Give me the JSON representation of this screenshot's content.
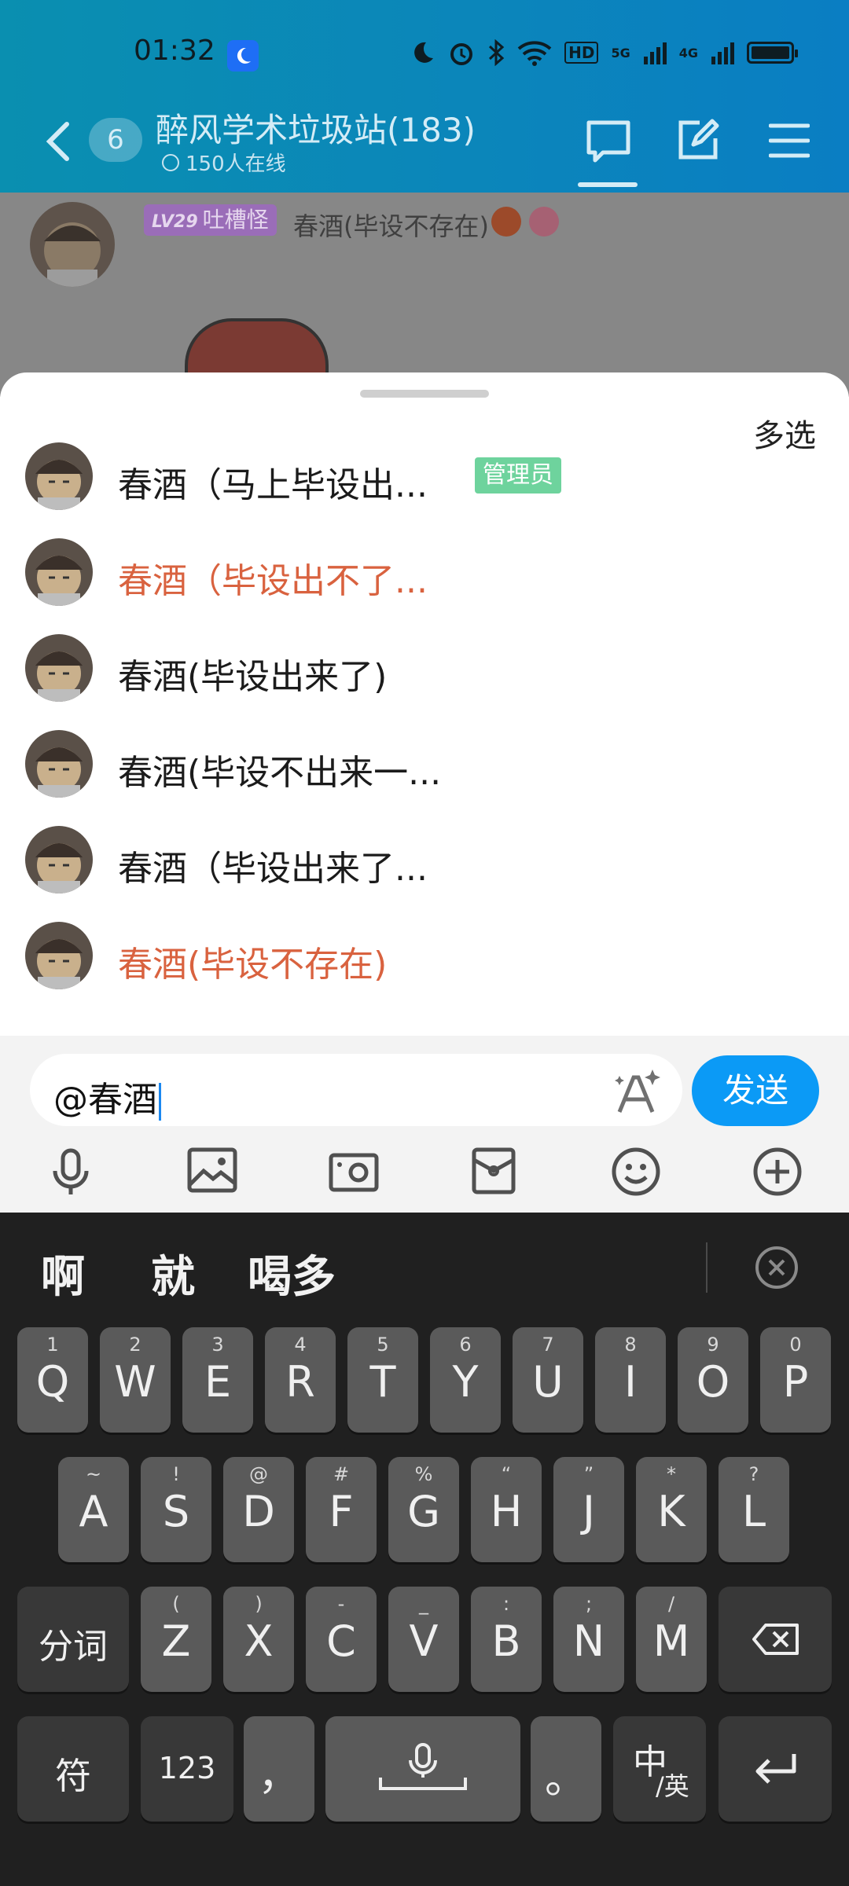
{
  "status_bar": {
    "time": "01:32",
    "hd_label": "HD",
    "sig1": "5G",
    "sig2": "4G"
  },
  "header": {
    "back_count": "6",
    "title": "醉风学术垃圾站(183)",
    "online": "150人在线"
  },
  "chat_preview": {
    "level": "LV29",
    "level_title": "吐槽怪",
    "sender": "春酒(毕设不存在)"
  },
  "mention_sheet": {
    "multi_select": "多选",
    "members": [
      {
        "name": "春酒（马上毕设出...",
        "red": false,
        "badge": "管理员"
      },
      {
        "name": "春酒（毕设出不了...",
        "red": true,
        "badge": ""
      },
      {
        "name": "春酒(毕设出来了)",
        "red": false,
        "badge": ""
      },
      {
        "name": "春酒(毕设不出来一...",
        "red": false,
        "badge": ""
      },
      {
        "name": "春酒（毕设出来了...",
        "red": false,
        "badge": ""
      },
      {
        "name": "春酒(毕设不存在)",
        "red": true,
        "badge": ""
      }
    ]
  },
  "composer": {
    "input_value": "@春酒",
    "send_label": "发送"
  },
  "keyboard": {
    "candidates": [
      "啊",
      "就",
      "喝多"
    ],
    "row1": [
      [
        "1",
        "Q"
      ],
      [
        "2",
        "W"
      ],
      [
        "3",
        "E"
      ],
      [
        "4",
        "R"
      ],
      [
        "5",
        "T"
      ],
      [
        "6",
        "Y"
      ],
      [
        "7",
        "U"
      ],
      [
        "8",
        "I"
      ],
      [
        "9",
        "O"
      ],
      [
        "0",
        "P"
      ]
    ],
    "row2": [
      [
        "~",
        "A"
      ],
      [
        "!",
        "S"
      ],
      [
        "@",
        "D"
      ],
      [
        "#",
        "F"
      ],
      [
        "%",
        "G"
      ],
      [
        "“",
        "H"
      ],
      [
        "”",
        "J"
      ],
      [
        "*",
        "K"
      ],
      [
        "?",
        "L"
      ]
    ],
    "row3_left": "分词",
    "row3": [
      [
        "(",
        "Z"
      ],
      [
        ")",
        "X"
      ],
      [
        "-",
        "C"
      ],
      [
        "_",
        "V"
      ],
      [
        ":",
        "B"
      ],
      [
        ";",
        "N"
      ],
      [
        "/",
        "M"
      ]
    ],
    "row4": {
      "symbol": "符",
      "num": "123",
      "comma": "，",
      "period": "。",
      "lang_main": "中",
      "lang_sub": "/英"
    }
  },
  "colors": {
    "accent": "#0b9af6",
    "red_name": "#d9623f",
    "admin_badge": "#6ed39d"
  }
}
